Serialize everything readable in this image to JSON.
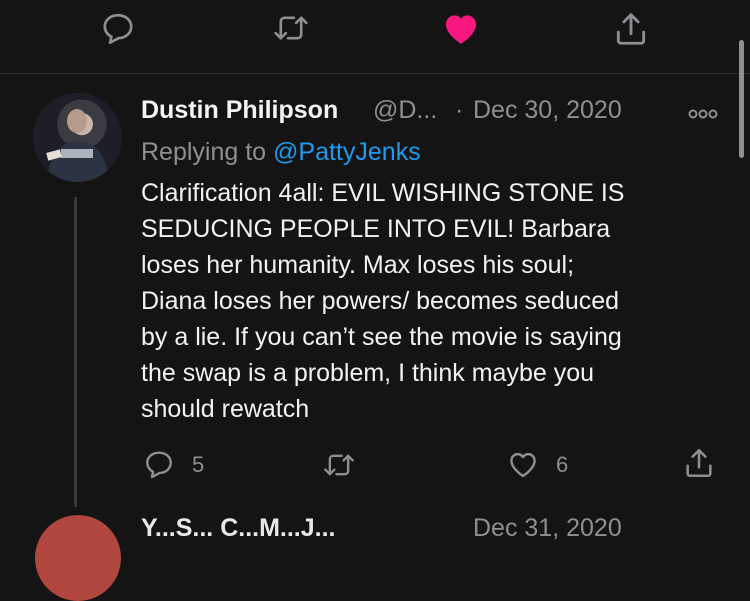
{
  "top_actions": {
    "reply_icon": "reply-icon",
    "retweet_icon": "retweet-icon",
    "like_icon": "heart-filled-icon",
    "share_icon": "share-icon",
    "like_color": "#f91880"
  },
  "tweet": {
    "name": "Dustin Philipson",
    "handle": "@D...",
    "separator": "·",
    "date": "Dec 30, 2020",
    "replying_prefix": "Replying to",
    "replying_to": "@PattyJenks",
    "text": "Clarification 4all: EVIL WISHING STONE IS\nSEDUCING PEOPLE INTO EVIL! Barbara\nloses her humanity. Max loses his soul;\nDiana loses her powers/ becomes seduced\nby a lie. If you can’t see the movie is saying\nthe swap is a problem, I think maybe you\nshould rewatch",
    "reply_count": "5",
    "like_count": "6",
    "mention_color": "#1d9bf0"
  },
  "next_tweet": {
    "name": "Y...S... C...M...J...",
    "date": "Dec 31, 2020"
  }
}
